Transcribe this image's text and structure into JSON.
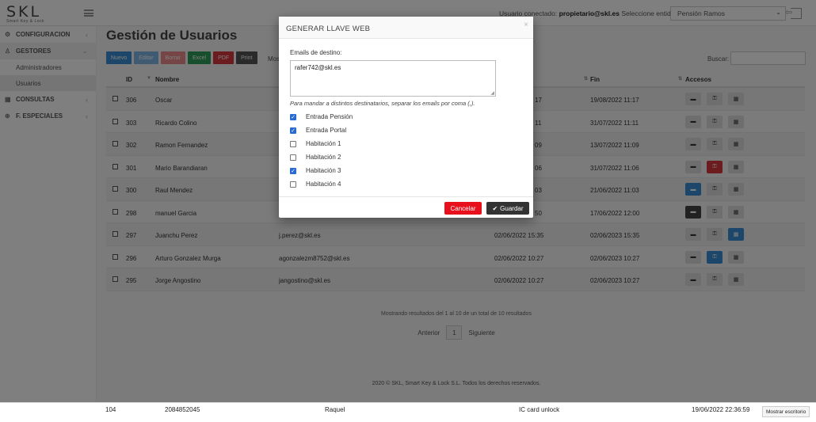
{
  "header": {
    "logo": "SKL",
    "logo_sub": "Smart Key & Lock",
    "user_label": "Usuario conectado:",
    "user_email": "propietario@skl.es",
    "entity_label": "Seleccione entidad",
    "entity_value": "Pensión Ramos"
  },
  "sidebar": {
    "items": [
      {
        "label": "Configuracion"
      },
      {
        "label": "Gestores"
      },
      {
        "label": "Consultas"
      },
      {
        "label": "F. Especiales"
      }
    ],
    "sub_items": [
      {
        "label": "Administradores"
      },
      {
        "label": "Usuarios"
      }
    ]
  },
  "main": {
    "title": "Gestión de Usuarios",
    "toolbar": {
      "nuevo": "Nuevo",
      "editar": "Editar",
      "borrar": "Borrar",
      "excel": "Excel",
      "pdf": "PDF",
      "print": "Print"
    },
    "mostrar_label": "Mos",
    "search_label": "Buscar:",
    "columns": {
      "id": "ID",
      "nombre": "Nombre",
      "fin": "Fin",
      "accesos": "Accesos"
    },
    "rows": [
      {
        "id": "306",
        "nombre": "Oscar",
        "email": "",
        "inicio": "17",
        "fin": "19/08/2022 11:17"
      },
      {
        "id": "303",
        "nombre": "Ricardo Colino",
        "email": "",
        "inicio": "11",
        "fin": "31/07/2022 11:11"
      },
      {
        "id": "302",
        "nombre": "Ramon Fernandez",
        "email": "",
        "inicio": "09",
        "fin": "13/07/2022 11:09"
      },
      {
        "id": "301",
        "nombre": "Mario Barandiaran",
        "email": "",
        "inicio": "06",
        "fin": "31/07/2022 11:06"
      },
      {
        "id": "300",
        "nombre": "Raul Mendez",
        "email": "",
        "inicio": "03",
        "fin": "21/06/2022 11:03"
      },
      {
        "id": "298",
        "nombre": "manuel Garcia",
        "email": "",
        "inicio": "50",
        "fin": "17/06/2022 12:00"
      },
      {
        "id": "297",
        "nombre": "Juanchu Perez",
        "email": "j.perez@skl.es",
        "inicio": "02/06/2022 15:35",
        "fin": "02/06/2023 15:35"
      },
      {
        "id": "296",
        "nombre": "Arturo Gonzalez Murga",
        "email": "agonzalezm8752@skl.es",
        "inicio": "02/06/2022 10:27",
        "fin": "02/06/2023 10:27"
      },
      {
        "id": "295",
        "nombre": "Jorge Angostino",
        "email": "jangostino@skl.es",
        "inicio": "02/06/2022 10:27",
        "fin": "02/06/2023 10:27"
      }
    ],
    "table_info": "Mostrando resultados del 1 al 10 de un total de 10 resultados",
    "pager": {
      "prev": "Anterior",
      "page": "1",
      "next": "Siguiente"
    },
    "footer": "2020 © SKL, Smart Key & Lock S.L. Todos los derechos reservados."
  },
  "modal": {
    "title": "GENERAR LLAVE WEB",
    "emails_label": "Emails de destino:",
    "emails_value": "rafer742@skl.es",
    "hint": "Para mandar a distintos destinatarios, separar los emails por coma (,).",
    "options": [
      {
        "label": "Entrada Pensión",
        "checked": true
      },
      {
        "label": "Entrada Portal",
        "checked": true
      },
      {
        "label": "Habitación 1",
        "checked": false
      },
      {
        "label": "Habitación 2",
        "checked": false
      },
      {
        "label": "Habitación 3",
        "checked": true
      },
      {
        "label": "Habitación 4",
        "checked": false
      }
    ],
    "cancel_label": "Cancelar",
    "save_label": "Guardar"
  },
  "bottom_strip": {
    "id": "104",
    "card": "2084852045",
    "name": "Raquel",
    "event": "IC card unlock",
    "datetime": "19/06/2022 22:36:59",
    "desktop_button": "Mostrar escritorio"
  },
  "colors": {
    "primary": "#3a8fd4",
    "danger": "#e8101c",
    "dark": "#333333",
    "checkbox": "#2a6bd1"
  }
}
